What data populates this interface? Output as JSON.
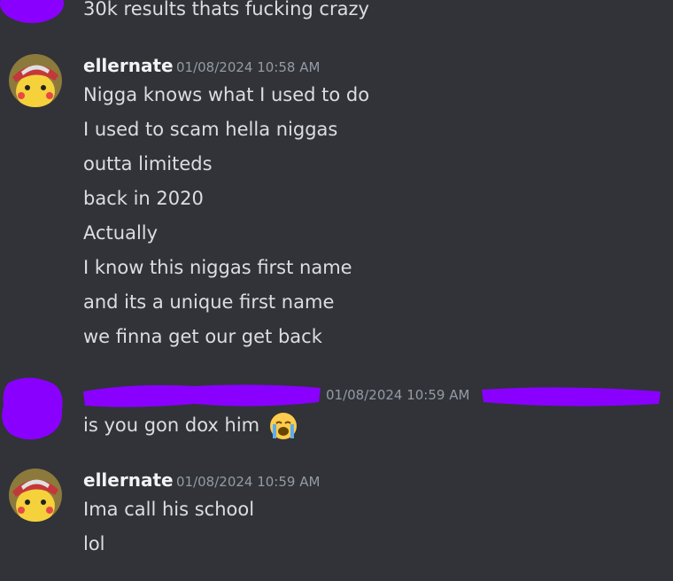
{
  "top_message": {
    "text": "30k results thats fucking crazy"
  },
  "groups": [
    {
      "author": "ellernate",
      "timestamp": "01/08/2024 10:58 AM",
      "lines": [
        "Nigga knows what I used to do",
        "I used to scam hella niggas",
        "outta limiteds",
        "back in 2020",
        "Actually",
        "I know this niggas first name",
        "and its a unique first name",
        "we finna get our get back"
      ]
    },
    {
      "author": "",
      "timestamp": "01/08/2024 10:59 AM",
      "lines": [
        "is you gon dox him"
      ],
      "emoji": "loudly-crying-face-icon"
    },
    {
      "author": "ellernate",
      "timestamp": "01/08/2024 10:59 AM",
      "lines": [
        "Ima call his school",
        "lol"
      ]
    }
  ],
  "colors": {
    "background": "#313338",
    "text": "#dbdee1",
    "author": "#f2f3f5",
    "timestamp": "#949ba4",
    "redaction": "#8a00ff"
  }
}
